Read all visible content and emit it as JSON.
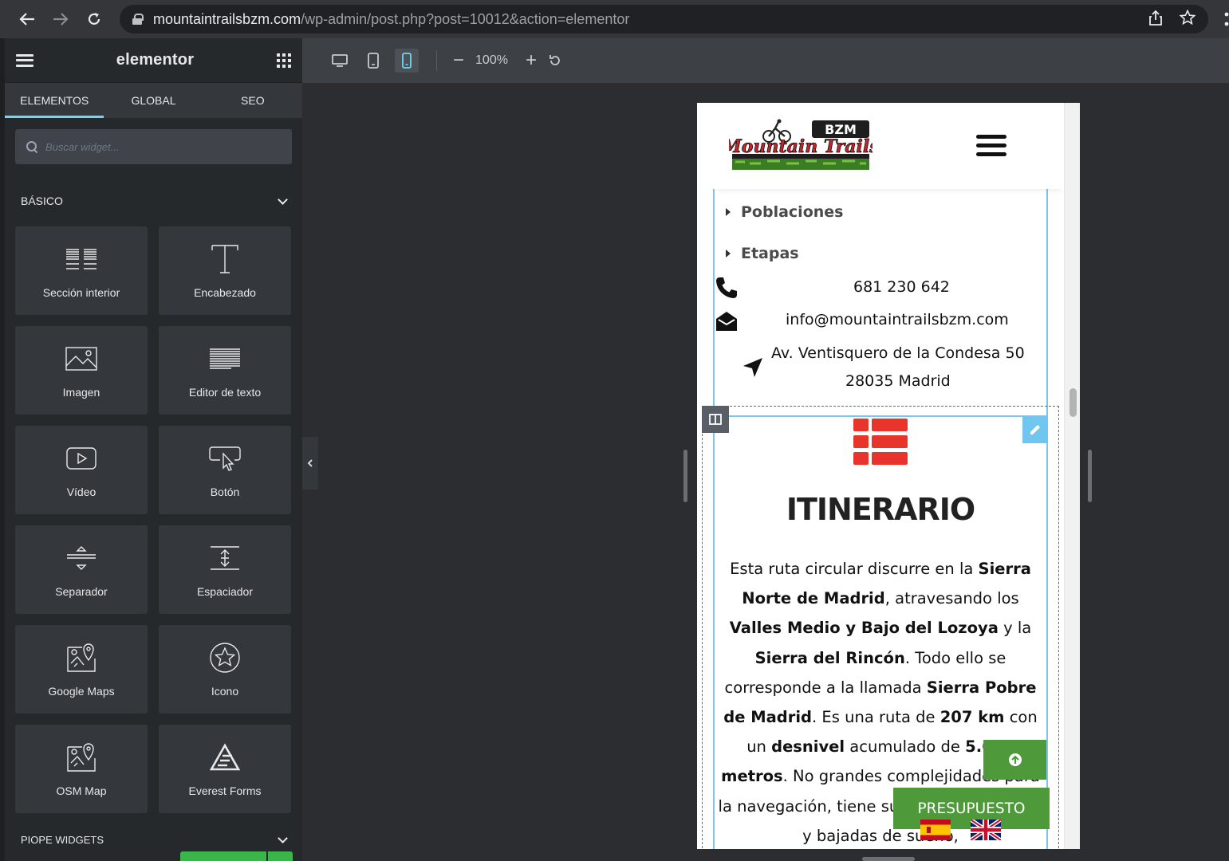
{
  "browser": {
    "url_host": "mountaintrailsbzm.com",
    "url_path": "/wp-admin/post.php?post=10012&action=elementor"
  },
  "panel": {
    "brand": "elementor",
    "tabs": [
      "ELEMENTOS",
      "GLOBAL",
      "SEO"
    ],
    "active_tab": "ELEMENTOS",
    "search_placeholder": "Buscar widget...",
    "category_basic": "BÁSICO",
    "category_next": "PIOPE WIDGETS",
    "widgets": [
      {
        "label": "Sección interior",
        "icon": "inner-section-icon"
      },
      {
        "label": "Encabezado",
        "icon": "heading-icon"
      },
      {
        "label": "Imagen",
        "icon": "image-icon"
      },
      {
        "label": "Editor de texto",
        "icon": "text-editor-icon"
      },
      {
        "label": "Vídeo",
        "icon": "video-icon"
      },
      {
        "label": "Botón",
        "icon": "button-icon"
      },
      {
        "label": "Separador",
        "icon": "divider-icon"
      },
      {
        "label": "Espaciador",
        "icon": "spacer-icon"
      },
      {
        "label": "Google Maps",
        "icon": "map-icon"
      },
      {
        "label": "Icono",
        "icon": "star-icon"
      },
      {
        "label": "OSM Map",
        "icon": "map-icon"
      },
      {
        "label": "Everest Forms",
        "icon": "everest-forms-icon"
      }
    ]
  },
  "toolbar": {
    "zoom": "100%",
    "active_device": "mobile"
  },
  "site": {
    "menu_items": [
      "Poblaciones",
      "Etapas"
    ],
    "phone": "681 230 642",
    "email": "info@mountaintrailsbzm.com",
    "address_line1": "Av. Ventisquero de la Condesa 50",
    "address_line2": "28035 Madrid",
    "itinerary_title": "ITINERARIO",
    "quote_button": "PRESUPUESTO",
    "colors": {
      "accent_green": "#4e9a3a",
      "itinerary_icon_red": "#e8342a",
      "editor_blue": "#71c6f0"
    }
  },
  "itinerary_paragraph": [
    {
      "t": "Esta ruta circular discurre en la ",
      "b": false
    },
    {
      "t": "Sierra Norte de Madrid",
      "b": true
    },
    {
      "t": ", atravesando los ",
      "b": false
    },
    {
      "t": "Valles Medio y Bajo del Lozoya",
      "b": true
    },
    {
      "t": " y la ",
      "b": false
    },
    {
      "t": "Sierra del Rincón",
      "b": true
    },
    {
      "t": ". Todo ello se corresponde a la llamada ",
      "b": false
    },
    {
      "t": "Sierra Pobre de Madrid",
      "b": true
    },
    {
      "t": ". Es una ruta de ",
      "b": false
    },
    {
      "t": "207 km",
      "b": true
    },
    {
      "t": " con un ",
      "b": false
    },
    {
      "t": "desnivel",
      "b": true
    },
    {
      "t": " acumulado de ",
      "b": false
    },
    {
      "t": "5.600 metros",
      "b": true
    },
    {
      "t": ". No grandes complejidades para la navegación, tiene su dureza y esfuerzo y bajadas de sueño,",
      "b": false
    }
  ]
}
